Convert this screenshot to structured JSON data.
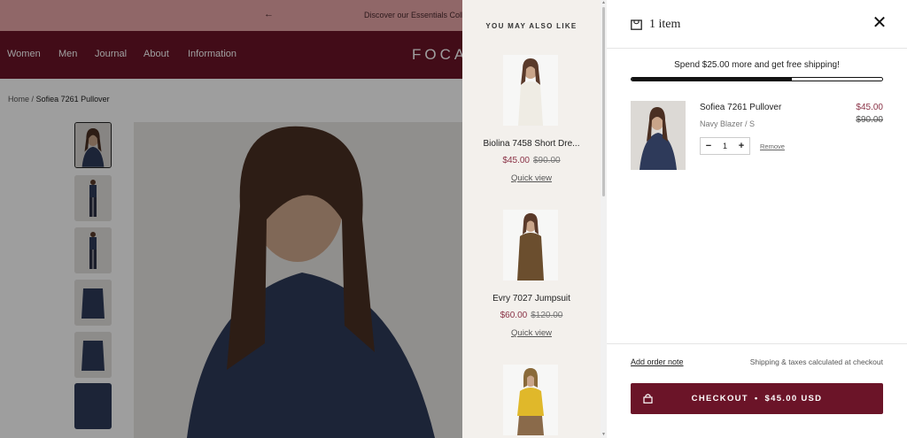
{
  "announcement": {
    "arrow": "←",
    "text": "Discover our Essentials Colle"
  },
  "nav": {
    "items": [
      "Women",
      "Men",
      "Journal",
      "About",
      "Information"
    ],
    "logo": "FOCA"
  },
  "breadcrumb": {
    "home": "Home",
    "separator": "/",
    "current": "Sofiea 7261 Pullover"
  },
  "recommendations": {
    "heading": "YOU MAY ALSO LIKE",
    "items": [
      {
        "name": "Biolina 7458 Short Dre...",
        "price": "$45.00",
        "compare": "$90.00",
        "action": "Quick view"
      },
      {
        "name": "Evry 7027 Jumpsuit",
        "price": "$60.00",
        "compare": "$120.00",
        "action": "Quick view"
      },
      {
        "name": "",
        "price": "",
        "compare": "",
        "action": ""
      }
    ]
  },
  "cart": {
    "count_label": "1 item",
    "close": "✕",
    "shipping_message": "Spend $25.00 more and get free shipping!",
    "shipping_progress": 0.64,
    "item": {
      "title": "Sofiea 7261 Pullover",
      "variant": "Navy Blazer / S",
      "price": "$45.00",
      "compare": "$90.00",
      "quantity": "1",
      "minus": "−",
      "plus": "+",
      "remove": "Remove"
    },
    "order_note": "Add order note",
    "tax_note": "Shipping & taxes calculated at checkout",
    "checkout": {
      "label": "CHECKOUT",
      "bullet": "•",
      "total": "$45.00 USD"
    }
  },
  "colors": {
    "brand": "#6b1428",
    "announcement_bg": "#e9a7a9",
    "sale_price": "#8a3246"
  }
}
